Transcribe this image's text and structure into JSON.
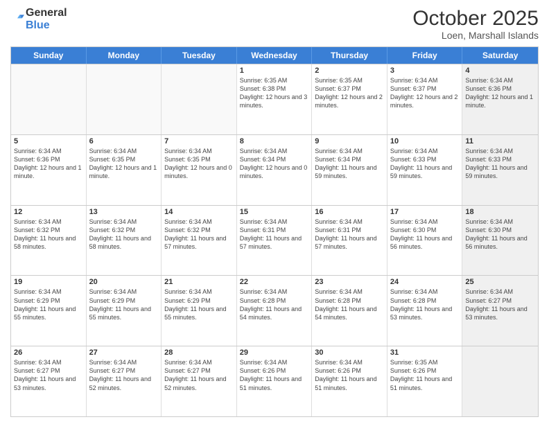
{
  "header": {
    "logo_general": "General",
    "logo_blue": "Blue",
    "main_title": "October 2025",
    "subtitle": "Loen, Marshall Islands"
  },
  "days_of_week": [
    "Sunday",
    "Monday",
    "Tuesday",
    "Wednesday",
    "Thursday",
    "Friday",
    "Saturday"
  ],
  "weeks": [
    [
      {
        "day": "",
        "info": "",
        "empty": true
      },
      {
        "day": "",
        "info": "",
        "empty": true
      },
      {
        "day": "",
        "info": "",
        "empty": true
      },
      {
        "day": "1",
        "info": "Sunrise: 6:35 AM\nSunset: 6:38 PM\nDaylight: 12 hours\nand 3 minutes.",
        "empty": false
      },
      {
        "day": "2",
        "info": "Sunrise: 6:35 AM\nSunset: 6:37 PM\nDaylight: 12 hours\nand 2 minutes.",
        "empty": false
      },
      {
        "day": "3",
        "info": "Sunrise: 6:34 AM\nSunset: 6:37 PM\nDaylight: 12 hours\nand 2 minutes.",
        "empty": false
      },
      {
        "day": "4",
        "info": "Sunrise: 6:34 AM\nSunset: 6:36 PM\nDaylight: 12 hours\nand 1 minute.",
        "empty": false,
        "shaded": true
      }
    ],
    [
      {
        "day": "5",
        "info": "Sunrise: 6:34 AM\nSunset: 6:36 PM\nDaylight: 12 hours\nand 1 minute.",
        "empty": false
      },
      {
        "day": "6",
        "info": "Sunrise: 6:34 AM\nSunset: 6:35 PM\nDaylight: 12 hours\nand 1 minute.",
        "empty": false
      },
      {
        "day": "7",
        "info": "Sunrise: 6:34 AM\nSunset: 6:35 PM\nDaylight: 12 hours\nand 0 minutes.",
        "empty": false
      },
      {
        "day": "8",
        "info": "Sunrise: 6:34 AM\nSunset: 6:34 PM\nDaylight: 12 hours\nand 0 minutes.",
        "empty": false
      },
      {
        "day": "9",
        "info": "Sunrise: 6:34 AM\nSunset: 6:34 PM\nDaylight: 11 hours\nand 59 minutes.",
        "empty": false
      },
      {
        "day": "10",
        "info": "Sunrise: 6:34 AM\nSunset: 6:33 PM\nDaylight: 11 hours\nand 59 minutes.",
        "empty": false
      },
      {
        "day": "11",
        "info": "Sunrise: 6:34 AM\nSunset: 6:33 PM\nDaylight: 11 hours\nand 59 minutes.",
        "empty": false,
        "shaded": true
      }
    ],
    [
      {
        "day": "12",
        "info": "Sunrise: 6:34 AM\nSunset: 6:32 PM\nDaylight: 11 hours\nand 58 minutes.",
        "empty": false
      },
      {
        "day": "13",
        "info": "Sunrise: 6:34 AM\nSunset: 6:32 PM\nDaylight: 11 hours\nand 58 minutes.",
        "empty": false
      },
      {
        "day": "14",
        "info": "Sunrise: 6:34 AM\nSunset: 6:32 PM\nDaylight: 11 hours\nand 57 minutes.",
        "empty": false
      },
      {
        "day": "15",
        "info": "Sunrise: 6:34 AM\nSunset: 6:31 PM\nDaylight: 11 hours\nand 57 minutes.",
        "empty": false
      },
      {
        "day": "16",
        "info": "Sunrise: 6:34 AM\nSunset: 6:31 PM\nDaylight: 11 hours\nand 57 minutes.",
        "empty": false
      },
      {
        "day": "17",
        "info": "Sunrise: 6:34 AM\nSunset: 6:30 PM\nDaylight: 11 hours\nand 56 minutes.",
        "empty": false
      },
      {
        "day": "18",
        "info": "Sunrise: 6:34 AM\nSunset: 6:30 PM\nDaylight: 11 hours\nand 56 minutes.",
        "empty": false,
        "shaded": true
      }
    ],
    [
      {
        "day": "19",
        "info": "Sunrise: 6:34 AM\nSunset: 6:29 PM\nDaylight: 11 hours\nand 55 minutes.",
        "empty": false
      },
      {
        "day": "20",
        "info": "Sunrise: 6:34 AM\nSunset: 6:29 PM\nDaylight: 11 hours\nand 55 minutes.",
        "empty": false
      },
      {
        "day": "21",
        "info": "Sunrise: 6:34 AM\nSunset: 6:29 PM\nDaylight: 11 hours\nand 55 minutes.",
        "empty": false
      },
      {
        "day": "22",
        "info": "Sunrise: 6:34 AM\nSunset: 6:28 PM\nDaylight: 11 hours\nand 54 minutes.",
        "empty": false
      },
      {
        "day": "23",
        "info": "Sunrise: 6:34 AM\nSunset: 6:28 PM\nDaylight: 11 hours\nand 54 minutes.",
        "empty": false
      },
      {
        "day": "24",
        "info": "Sunrise: 6:34 AM\nSunset: 6:28 PM\nDaylight: 11 hours\nand 53 minutes.",
        "empty": false
      },
      {
        "day": "25",
        "info": "Sunrise: 6:34 AM\nSunset: 6:27 PM\nDaylight: 11 hours\nand 53 minutes.",
        "empty": false,
        "shaded": true
      }
    ],
    [
      {
        "day": "26",
        "info": "Sunrise: 6:34 AM\nSunset: 6:27 PM\nDaylight: 11 hours\nand 53 minutes.",
        "empty": false
      },
      {
        "day": "27",
        "info": "Sunrise: 6:34 AM\nSunset: 6:27 PM\nDaylight: 11 hours\nand 52 minutes.",
        "empty": false
      },
      {
        "day": "28",
        "info": "Sunrise: 6:34 AM\nSunset: 6:27 PM\nDaylight: 11 hours\nand 52 minutes.",
        "empty": false
      },
      {
        "day": "29",
        "info": "Sunrise: 6:34 AM\nSunset: 6:26 PM\nDaylight: 11 hours\nand 51 minutes.",
        "empty": false
      },
      {
        "day": "30",
        "info": "Sunrise: 6:34 AM\nSunset: 6:26 PM\nDaylight: 11 hours\nand 51 minutes.",
        "empty": false
      },
      {
        "day": "31",
        "info": "Sunrise: 6:35 AM\nSunset: 6:26 PM\nDaylight: 11 hours\nand 51 minutes.",
        "empty": false
      },
      {
        "day": "",
        "info": "",
        "empty": true,
        "shaded": true
      }
    ]
  ]
}
